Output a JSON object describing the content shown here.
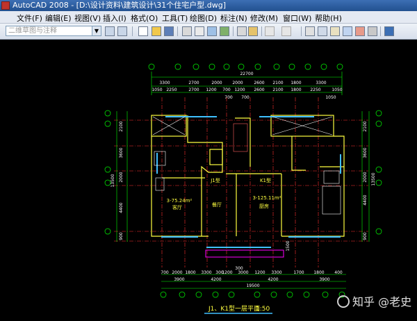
{
  "window": {
    "title": "AutoCAD 2008 - [D:\\设计资料\\建筑设计\\31个住宅户型.dwg]"
  },
  "menu": [
    "文件(F)",
    "编辑(E)",
    "视图(V)",
    "插入(I)",
    "格式(O)",
    "工具(T)",
    "绘图(D)",
    "标注(N)",
    "修改(M)",
    "窗口(W)",
    "帮助(H)"
  ],
  "toolbar": {
    "workspace_combo": "二维草图与注释",
    "icons": [
      "new-icon",
      "open-icon",
      "save-icon",
      "print-icon",
      "preview-icon",
      "publish-icon",
      "plot-icon",
      "cut-icon",
      "match-icon",
      "undo-icon",
      "redo-icon",
      "pan-icon",
      "zoom-icon",
      "properties-icon",
      "designcenter-icon",
      "toolpalette-icon",
      "sheetset-icon",
      "markup-icon",
      "calculator-icon",
      "help-icon"
    ]
  },
  "drawing": {
    "dims_top_total": "22700",
    "dims_top_row1": [
      "3300",
      "2700",
      "2000",
      "2000",
      "2600",
      "2100",
      "1800",
      "3300"
    ],
    "dims_top_row2": [
      "1050",
      "2250",
      "2700",
      "1200",
      "700",
      "1200",
      "2600",
      "2100",
      "1800",
      "2250",
      "1050"
    ],
    "dims_top_row3": [
      "700",
      "700"
    ],
    "dims_top_side": "1050",
    "dims_left": [
      "2100",
      "3600",
      "2000",
      "4400",
      "900"
    ],
    "dims_left_total": "13500",
    "dims_right": [
      "2100",
      "3600",
      "2000",
      "4400",
      "900"
    ],
    "dims_right_total": "13500",
    "dims_bottom_row1": [
      "700",
      "2000",
      "1800",
      "3300",
      "300",
      "1200",
      "3000",
      "1200",
      "3300",
      "1700",
      "1800",
      "400"
    ],
    "dims_bottom_row2": [
      "3900",
      "4200",
      "4200",
      "3900"
    ],
    "dims_bottom_total": "19500",
    "dims_bottom_mid": "1500",
    "dims_bottom_small": "300",
    "room_labels": [
      "J1型",
      "K1型",
      "3-75.24m²",
      "3-125.11m²",
      "客厅",
      "餐厅",
      "厨房"
    ],
    "drawing_title": "J1、K1型一层平面",
    "drawing_scale": "1:50"
  },
  "watermark": {
    "text": "知乎 @老史"
  },
  "colors": {
    "title_bar": "#22508f",
    "canvas": "#000000",
    "dimension": "#00ff00",
    "wall": "#ffff00",
    "axis": "#ff0000",
    "window": "#00c0ff",
    "text": "#ffffff"
  }
}
